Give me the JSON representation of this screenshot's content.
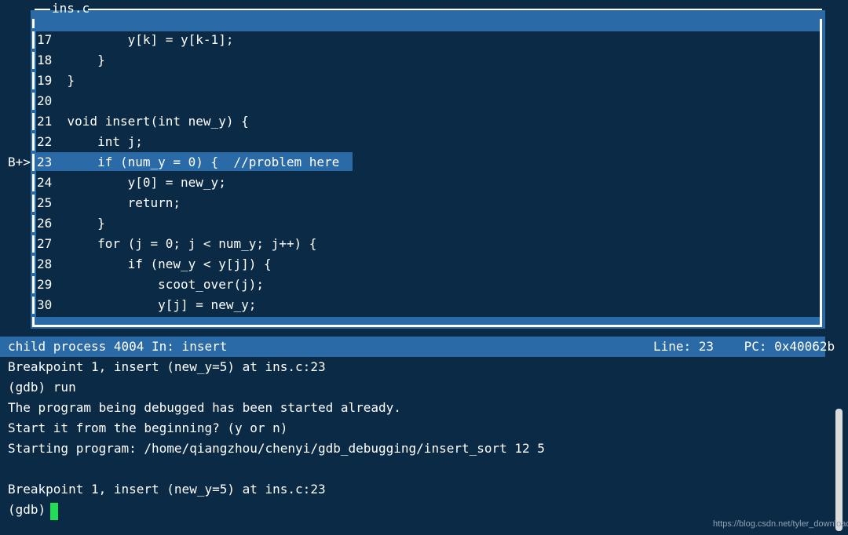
{
  "source_window": {
    "title": "ins.c",
    "lines": [
      {
        "no": "17",
        "code": "            y[k] = y[k-1];"
      },
      {
        "no": "18",
        "code": "        }"
      },
      {
        "no": "19",
        "code": "    }"
      },
      {
        "no": "20",
        "code": ""
      },
      {
        "no": "21",
        "code": "    void insert(int new_y) {"
      },
      {
        "no": "22",
        "code": "        int j;"
      },
      {
        "no": "23",
        "code": "        if (num_y = 0) {  //problem here"
      },
      {
        "no": "24",
        "code": "            y[0] = new_y;"
      },
      {
        "no": "25",
        "code": "            return;"
      },
      {
        "no": "26",
        "code": "        }"
      },
      {
        "no": "27",
        "code": "        for (j = 0; j < num_y; j++) {"
      },
      {
        "no": "28",
        "code": "            if (new_y < y[j]) {"
      },
      {
        "no": "29",
        "code": "                scoot_over(j);"
      },
      {
        "no": "30",
        "code": "                y[j] = new_y;"
      }
    ],
    "breakpoint_marker": "B+>",
    "current_line": "23"
  },
  "status_bar": {
    "left": "child process 4004 In: insert",
    "right": "Line: 23    PC: 0x40062b"
  },
  "console": {
    "lines": [
      "Breakpoint 1, insert (new_y=5) at ins.c:23",
      "(gdb) run",
      "The program being debugged has been started already.",
      "Start it from the beginning? (y or n)",
      "Starting program: /home/qiangzhou/chenyi/gdb_debugging/insert_sort 12 5",
      "",
      "Breakpoint 1, insert (new_y=5) at ins.c:23",
      "(gdb) "
    ]
  },
  "watermark": "https://blog.csdn.net/tyler_download",
  "colors": {
    "background": "#0b2a45",
    "accent": "#2a6aa6",
    "cursor": "#22dd55",
    "text": "#ffffff"
  }
}
